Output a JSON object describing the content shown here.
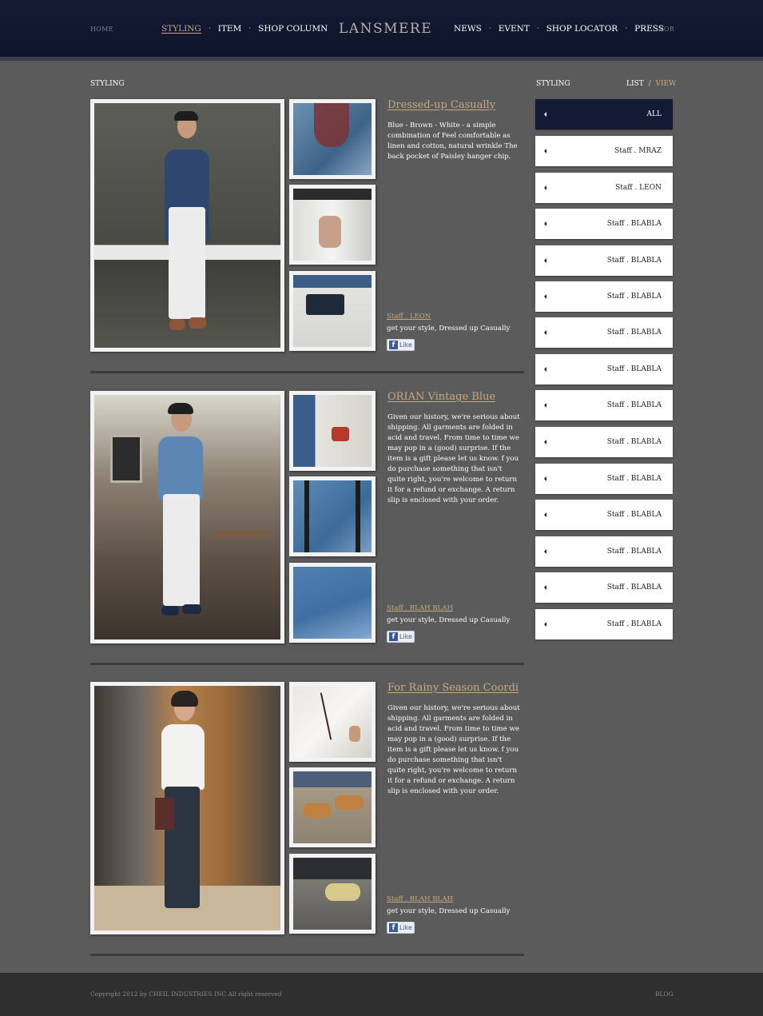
{
  "header": {
    "home": "HOME",
    "logo": "LANSMERE",
    "kor": "KOR",
    "nav_left": [
      "STYLING",
      "ITEM",
      "SHOP COLUMN"
    ],
    "nav_right": [
      "NEWS",
      "EVENT",
      "SHOP LOCATOR",
      "PRESS"
    ],
    "active_nav": "STYLING",
    "separator": "·"
  },
  "main": {
    "section_title": "STYLING",
    "posts": [
      {
        "title": "Dressed-up Casually",
        "description": "Blue - Brown - White - a simple combination of Feel comfortable as linen and cotton, natural wrinkle The back pocket of Paisley hanger chip.",
        "staff": "Staff . LEON",
        "tagline": "get your style, Dressed up Casually",
        "like_label": "Like"
      },
      {
        "title": "ORIAN Vintage Blue",
        "description": "Given our history, we're serious about shipping. All garments are folded in acid and travel. From time to time we may pop in a (good) surprise. If the item is a gift please let us know. f you do purchase something that isn't quite right, you're welcome to return it for a refund or exchange. A return slip is enclosed with your order.",
        "staff": "Staff . BLAH BLAH",
        "tagline": "get your style, Dressed up Casually",
        "like_label": "Like"
      },
      {
        "title": "For Rainy Season Coordi",
        "description": "Given our history, we're serious about shipping. All garments are folded in acid and travel. From time to time we may pop in a (good) surprise. If the item is a gift please let us know. f you do purchase something that isn't quite right, you're welcome to return it for a refund or exchange. A return slip is enclosed with your order.",
        "staff": "Staff . BLAH BLAH",
        "tagline": "get your style, Dressed up Casually",
        "like_label": "Like"
      }
    ]
  },
  "sidebar": {
    "title": "STYLING",
    "list_label": "LIST",
    "separator": "/",
    "view_label": "VIEW",
    "items": [
      "ALL",
      "Staff . MRAZ",
      "Staff . LEON",
      "Staff . BLABLA",
      "Staff . BLABLA",
      "Staff . BLABLA",
      "Staff . BLABLA",
      "Staff . BLABLA",
      "Staff . BLABLA",
      "Staff . BLABLA",
      "Staff . BLABLA",
      "Staff . BLABLA",
      "Staff . BLABLA",
      "Staff . BLABLA",
      "Staff . BLABLA"
    ],
    "active_index": 0
  },
  "footer": {
    "copyright": "Copyright 2012 by CHEIL INDUSTRIES INC All right reserved",
    "blog": "BLOG"
  },
  "colors": {
    "header_bg": "#141a33",
    "page_bg": "#5b5b5b",
    "accent_gold": "#c7a881",
    "footer_bg": "#2f2f2f"
  }
}
